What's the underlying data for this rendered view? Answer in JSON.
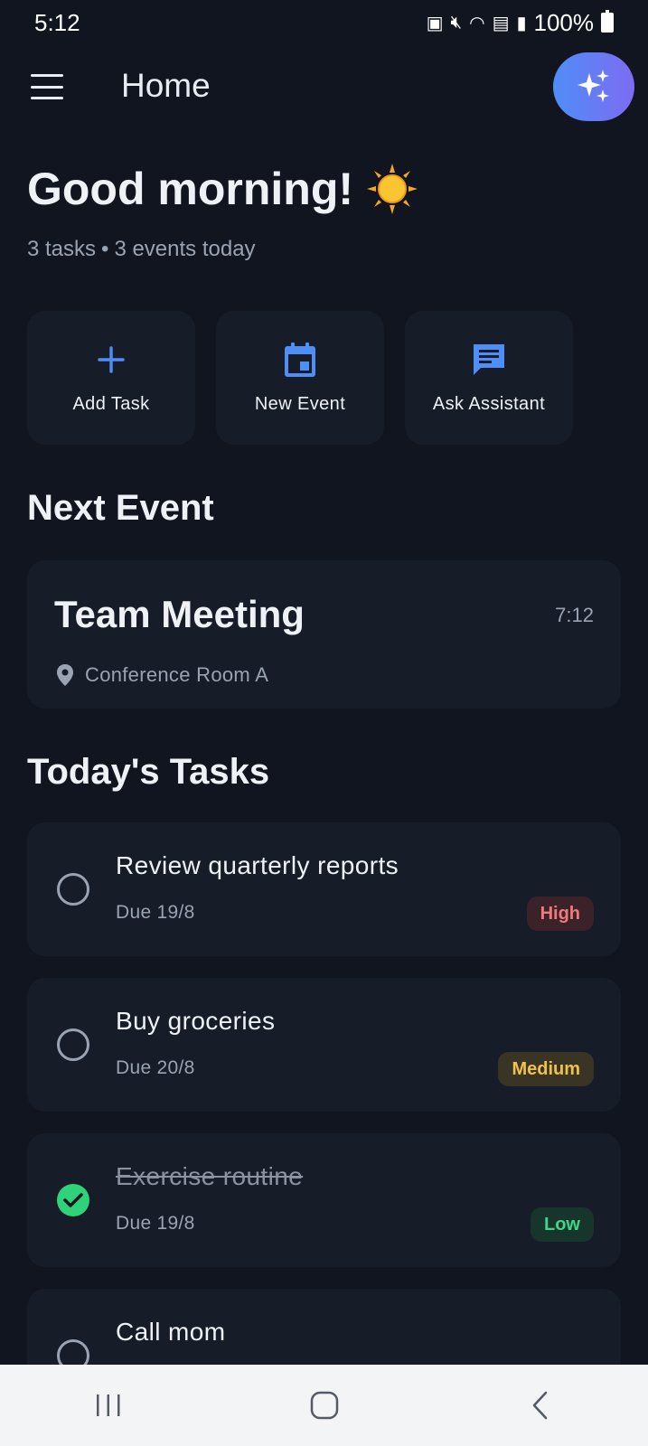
{
  "status_bar": {
    "time": "5:12",
    "battery": "100%"
  },
  "app_bar": {
    "title": "Home",
    "menu_icon": "hamburger-menu-icon",
    "assistant_icon": "sparkles-icon"
  },
  "greeting": {
    "text": "Good morning!",
    "emoji": "☀️"
  },
  "summary": {
    "tasks": "3 tasks",
    "separator": "•",
    "events": "3 events today"
  },
  "quick_actions": [
    {
      "label": "Add Task",
      "icon": "plus-icon"
    },
    {
      "label": "New Event",
      "icon": "calendar-icon"
    },
    {
      "label": "Ask Assistant",
      "icon": "chat-icon"
    }
  ],
  "next_event": {
    "section_title": "Next Event",
    "title": "Team Meeting",
    "time": "7:12",
    "location": "Conference Room A"
  },
  "tasks_section": {
    "section_title": "Today's Tasks",
    "items": [
      {
        "title": "Review quarterly reports",
        "due": "Due 19/8",
        "priority": "High",
        "done": false
      },
      {
        "title": "Buy groceries",
        "due": "Due 20/8",
        "priority": "Medium",
        "done": false
      },
      {
        "title": "Exercise routine",
        "due": "Due 19/8",
        "priority": "Low",
        "done": true
      },
      {
        "title": "Call mom",
        "due": "",
        "priority": "",
        "done": false
      }
    ]
  },
  "colors": {
    "background": "#101520",
    "card": "#171d28",
    "accent_blue": "#4f8df7",
    "priority_high_bg": "#3a2228",
    "priority_high_fg": "#f07a7a",
    "priority_medium_bg": "#3a3424",
    "priority_medium_fg": "#f0c24a",
    "priority_low_bg": "#17352a",
    "priority_low_fg": "#3fd68a",
    "done_green": "#2fd279"
  }
}
